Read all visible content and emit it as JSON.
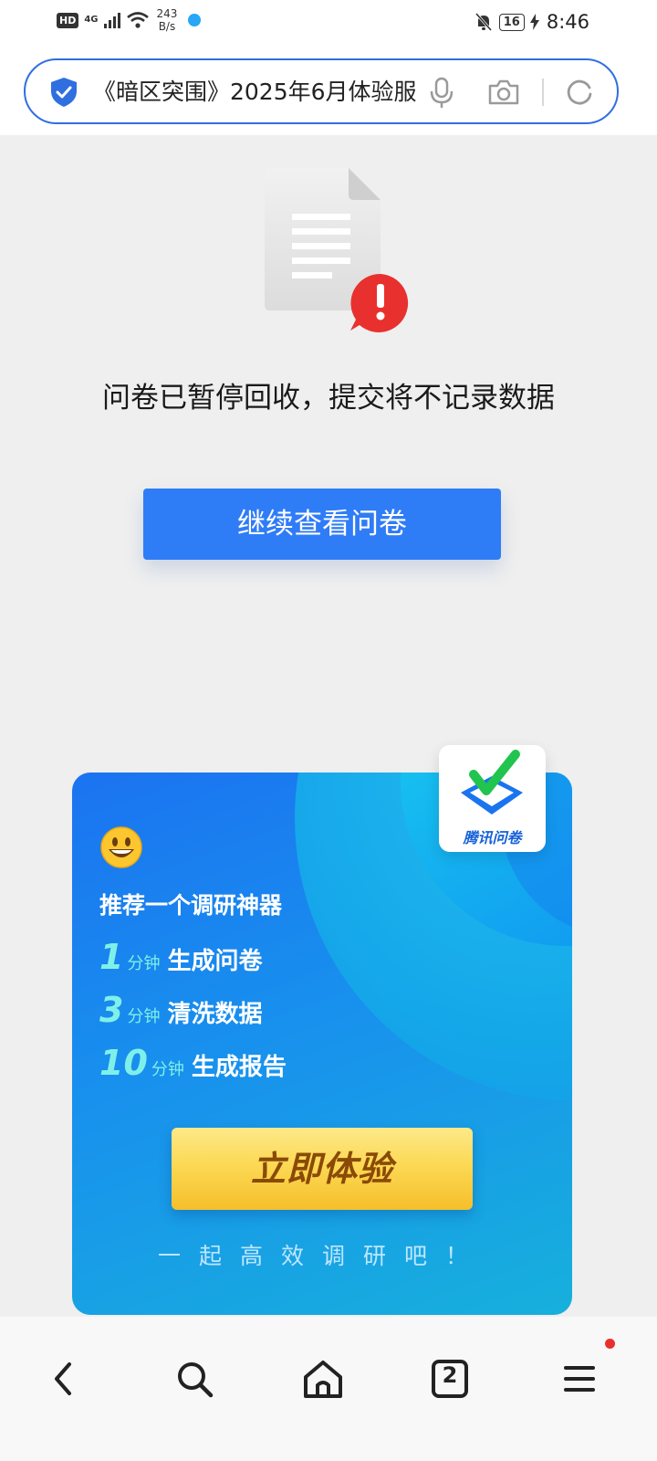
{
  "status_bar": {
    "hd": "HD",
    "network": "4G",
    "speed_value": "243",
    "speed_unit": "B/s",
    "battery": "16",
    "time": "8:46"
  },
  "address_bar": {
    "url_text": "《暗区突围》2025年6月体验服",
    "icons": [
      "shield-check-icon",
      "microphone-icon",
      "camera-icon",
      "refresh-icon"
    ]
  },
  "notice": {
    "message": "问卷已暂停回收，提交将不记录数据",
    "continue_label": "继续查看问卷"
  },
  "promo": {
    "headline": "推荐一个调研神器",
    "features": [
      {
        "num": "1",
        "unit": "分钟",
        "text": "生成问卷"
      },
      {
        "num": "3",
        "unit": "分钟",
        "text": "清洗数据"
      },
      {
        "num": "10",
        "unit": "分钟",
        "text": "生成报告"
      }
    ],
    "cta_label": "立即体验",
    "tagline": "一起高效调研吧！",
    "logo_text": "腾讯问卷"
  },
  "bottom_nav": {
    "tab_count": "2",
    "items": [
      "back-icon",
      "search-icon",
      "home-icon",
      "tabs-icon",
      "menu-icon"
    ]
  },
  "colors": {
    "accent": "#2f7cf7",
    "card_blue": "#1890ee",
    "cta_gold": "#fcd955",
    "alert_red": "#e8312e"
  }
}
